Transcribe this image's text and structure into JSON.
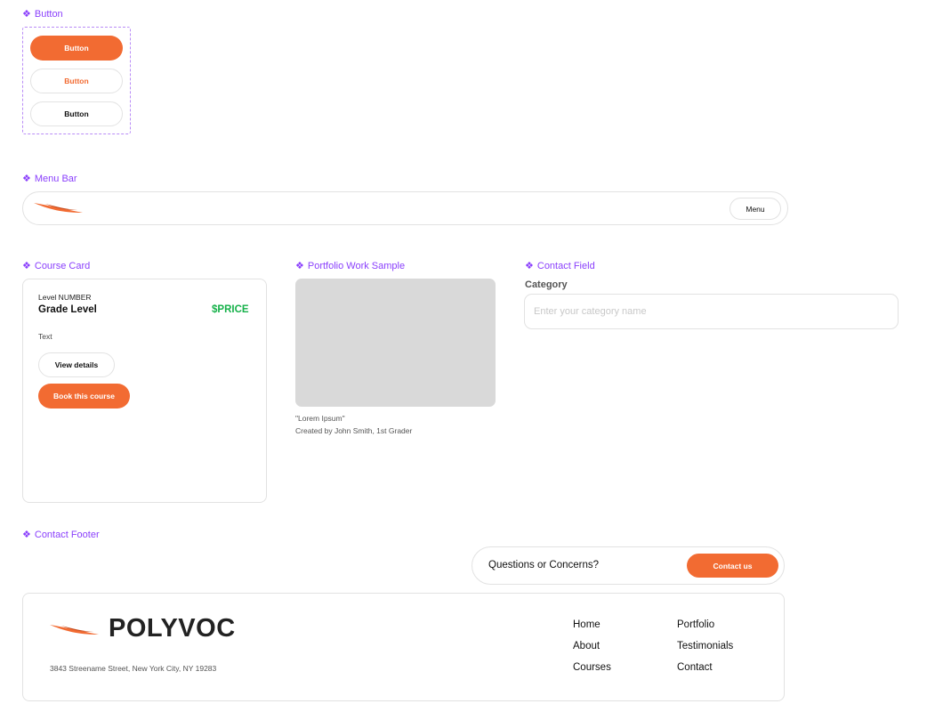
{
  "labels": {
    "button": "Button",
    "menu_bar": "Menu Bar",
    "course_card": "Course Card",
    "portfolio": "Portfolio Work Sample",
    "contact_field": "Contact Field",
    "contact_footer": "Contact Footer",
    "glyph": "❖"
  },
  "buttons": {
    "primary": "Button",
    "secondary": "Button",
    "tertiary": "Button"
  },
  "menu_bar": {
    "menu": "Menu"
  },
  "course_card": {
    "level": "Level NUMBER",
    "grade": "Grade Level",
    "price": "$PRICE",
    "text": "Text",
    "view_details": "View details",
    "book": "Book this course"
  },
  "portfolio": {
    "title": "\"Lorem Ipsum\"",
    "caption": "Created by John Smith, 1st Grader"
  },
  "contact_field": {
    "label": "Category",
    "placeholder": "Enter your category name"
  },
  "footer": {
    "question": "Questions or Concerns?",
    "contact_button": "Contact us",
    "brand": "POLYVOC",
    "address": "3843 Streename Street, New York City, NY 19283",
    "nav": [
      "Home",
      "About",
      "Courses",
      "Portfolio",
      "Testimonials",
      "Contact"
    ]
  },
  "colors": {
    "accent": "#f26b32",
    "label_purple": "#8a3ffc",
    "price_green": "#16b14a",
    "border": "#e2e2e2"
  },
  "icons": {
    "logo": "polyvoc-swoosh-logo",
    "component": "component-diamond-icon"
  }
}
